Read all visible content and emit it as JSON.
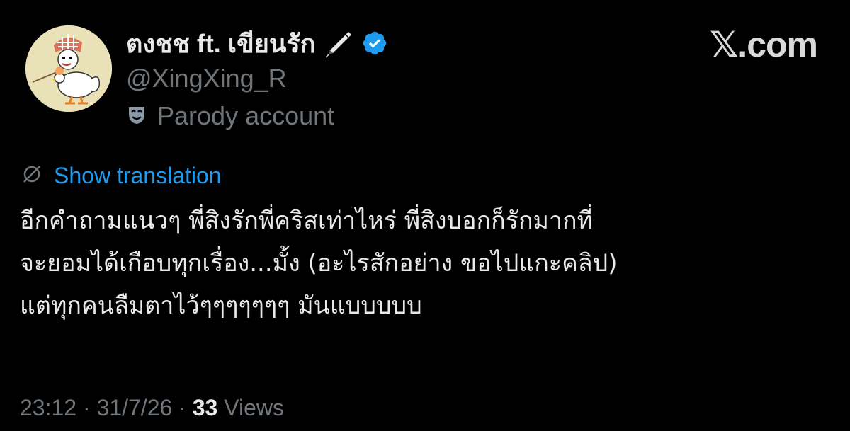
{
  "author": {
    "display_name": "ตงชช ft. เขียนรัก",
    "handle": "@XingXing_R",
    "parody_label": "Parody account",
    "verified_color": "#1d9bf0",
    "icons": [
      "pen-icon",
      "verified-badge-icon",
      "parody-mask-icon"
    ]
  },
  "brand": "𝕏.com",
  "translation": {
    "label": "Show translation",
    "icon": "translate-globe-icon"
  },
  "tweet": {
    "lines": [
      "อีกคำถามแนวๆ พี่สิงรักพี่คริสเท่าไหร่ พี่สิงบอกก็รักมากที่",
      "จะยอมได้เกือบทุกเรื่อง...มั้ง (อะไรสักอย่าง ขอไปแกะคลิป)",
      "แต่ทุกคนลืมตาไว้ๆๆๆๆๆๆๆ มันแบบบบบ"
    ]
  },
  "meta": {
    "time": "23:12",
    "separator": " · ",
    "date": "31/7/26",
    "views_count": "33",
    "views_label": " Views"
  },
  "colors": {
    "background": "#000000",
    "text_primary": "#e7e9ea",
    "text_secondary": "#71767b",
    "link": "#1d9bf0"
  }
}
